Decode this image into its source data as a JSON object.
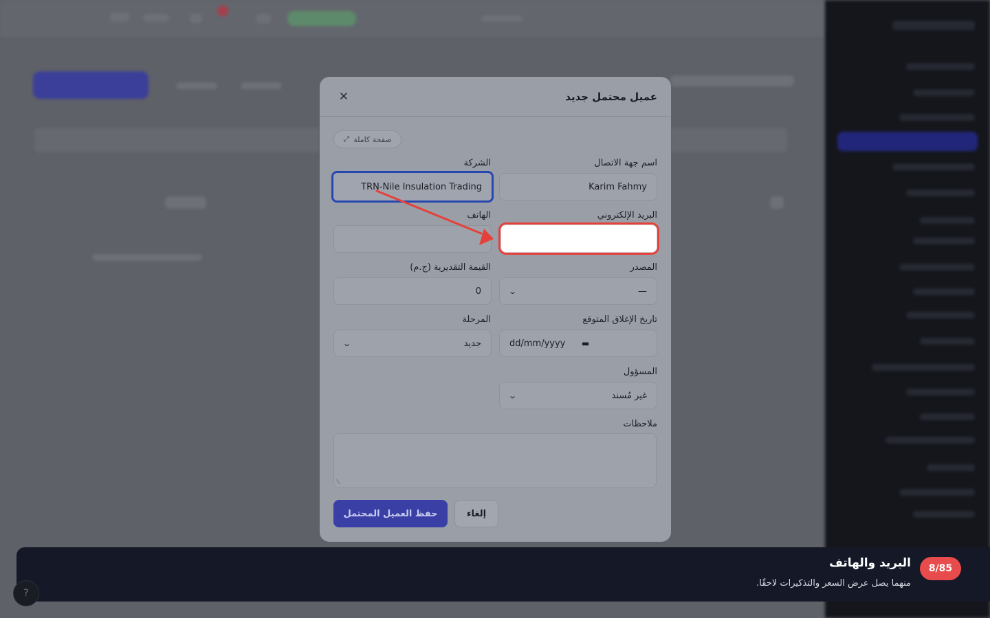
{
  "modal": {
    "title": "عميل محتمل جديد",
    "close_icon": "close-icon",
    "fullpage_label": "صفحة كاملة",
    "fullpage_icon": "expand-icon",
    "fields": {
      "contact_name": {
        "label": "اسم جهة الاتصال",
        "value": "Karim Fahmy"
      },
      "company": {
        "label": "الشركة",
        "value": "TRN-Nile Insulation Trading"
      },
      "email": {
        "label": "البريد الإلكتروني",
        "value": ""
      },
      "phone": {
        "label": "الهاتف",
        "value": ""
      },
      "source": {
        "label": "المصدر",
        "value": "—"
      },
      "estimated_value": {
        "label": "القيمة التقديرية (ج.م)",
        "value": "0"
      },
      "expected_close": {
        "label": "تاريخ الإغلاق المتوقع",
        "placeholder": "dd/mm/yyyy"
      },
      "stage": {
        "label": "المرحلة",
        "value": "جديد"
      },
      "owner": {
        "label": "المسؤول",
        "value": "غير مُسند"
      },
      "notes": {
        "label": "ملاحظات",
        "value": ""
      }
    },
    "save_label": "حفظ العميل المحتمل",
    "cancel_label": "إلغاء"
  },
  "banner": {
    "step": "8/85",
    "title": "البريد والهاتف",
    "subtitle": "منهما يصل عرض السعر والتذكيرات لاحقًا."
  },
  "colors": {
    "highlight": "#e5413a",
    "focus": "#2747b0",
    "primary": "#3a3fa6",
    "banner_bg": "#151827",
    "badge": "#e84b4b"
  }
}
